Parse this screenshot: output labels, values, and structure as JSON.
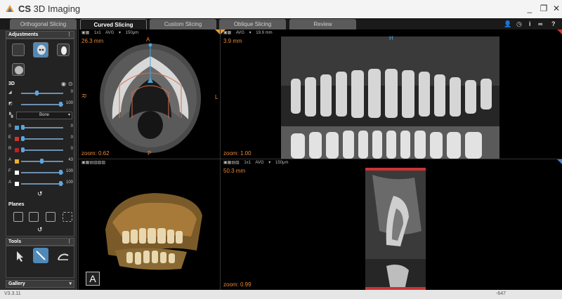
{
  "app": {
    "title_prefix": "CS",
    "title_rest": " 3D Imaging",
    "logo_icon": "cs-3d-imaging-logo",
    "window_controls": [
      "_",
      "❐",
      "✕"
    ]
  },
  "tabs": [
    {
      "label": "Orthogonal Slicing"
    },
    {
      "label": "Curved Slicing"
    },
    {
      "label": "Custom Slicing"
    },
    {
      "label": "Oblique Slicing"
    },
    {
      "label": "Review"
    }
  ],
  "active_tab": "Curved Slicing",
  "toolbar_icons": [
    "user-icon",
    "clock-icon",
    "info-icon",
    "glasses-icon",
    "help-icon"
  ],
  "toolbar_glyphs": {
    "user": "👤",
    "clock": "◷",
    "info": "i",
    "glasses": "∞",
    "help": "?"
  },
  "left_panel": {
    "adjustments": {
      "title": "Adjustments",
      "mode_label": "3D",
      "sliders_top": [
        {
          "label": "◢",
          "value": "0"
        },
        {
          "label": "◩",
          "value": "100"
        }
      ],
      "preset": "Bone",
      "color_sliders": [
        {
          "label": "S",
          "color": "#4aa6d8",
          "value": "0"
        },
        {
          "label": "E",
          "color": "#c33",
          "value": "0"
        },
        {
          "label": "R",
          "color": "#b22",
          "value": "0"
        },
        {
          "label": "A",
          "color": "#e6b030",
          "value": "43"
        },
        {
          "label": "F",
          "color": "#ffffff",
          "value": "100"
        },
        {
          "label": "A",
          "color": "#ffffff",
          "value": "100"
        }
      ]
    },
    "planes": {
      "title": "Planes"
    },
    "tools": {
      "title": "Tools"
    },
    "gallery": {
      "title": "Gallery"
    }
  },
  "viewports": {
    "axial": {
      "toolbar": {
        "ratio": "1x1",
        "mode": "AVG",
        "thickness": "150μm"
      },
      "distance": "26.3 mm",
      "zoom": "zoom: 0.62",
      "label_top": "A",
      "label_bottom": "P",
      "label_left": "R",
      "label_right": "L"
    },
    "panoramic": {
      "toolbar": {
        "mode": "AVG",
        "thickness": "19.9 mm"
      },
      "distance": "3.9 mm",
      "zoom": "zoom: 1.00",
      "label_top": "H"
    },
    "volume": {
      "toolbar": {},
      "orientation": "A"
    },
    "cross": {
      "toolbar": {
        "ratio": "1x1",
        "mode": "AVG",
        "thickness": "150μm"
      },
      "distance": "50.3 mm",
      "zoom": "zoom: 0.99"
    }
  },
  "status": {
    "version": "V3.3.11",
    "value": "-647"
  }
}
